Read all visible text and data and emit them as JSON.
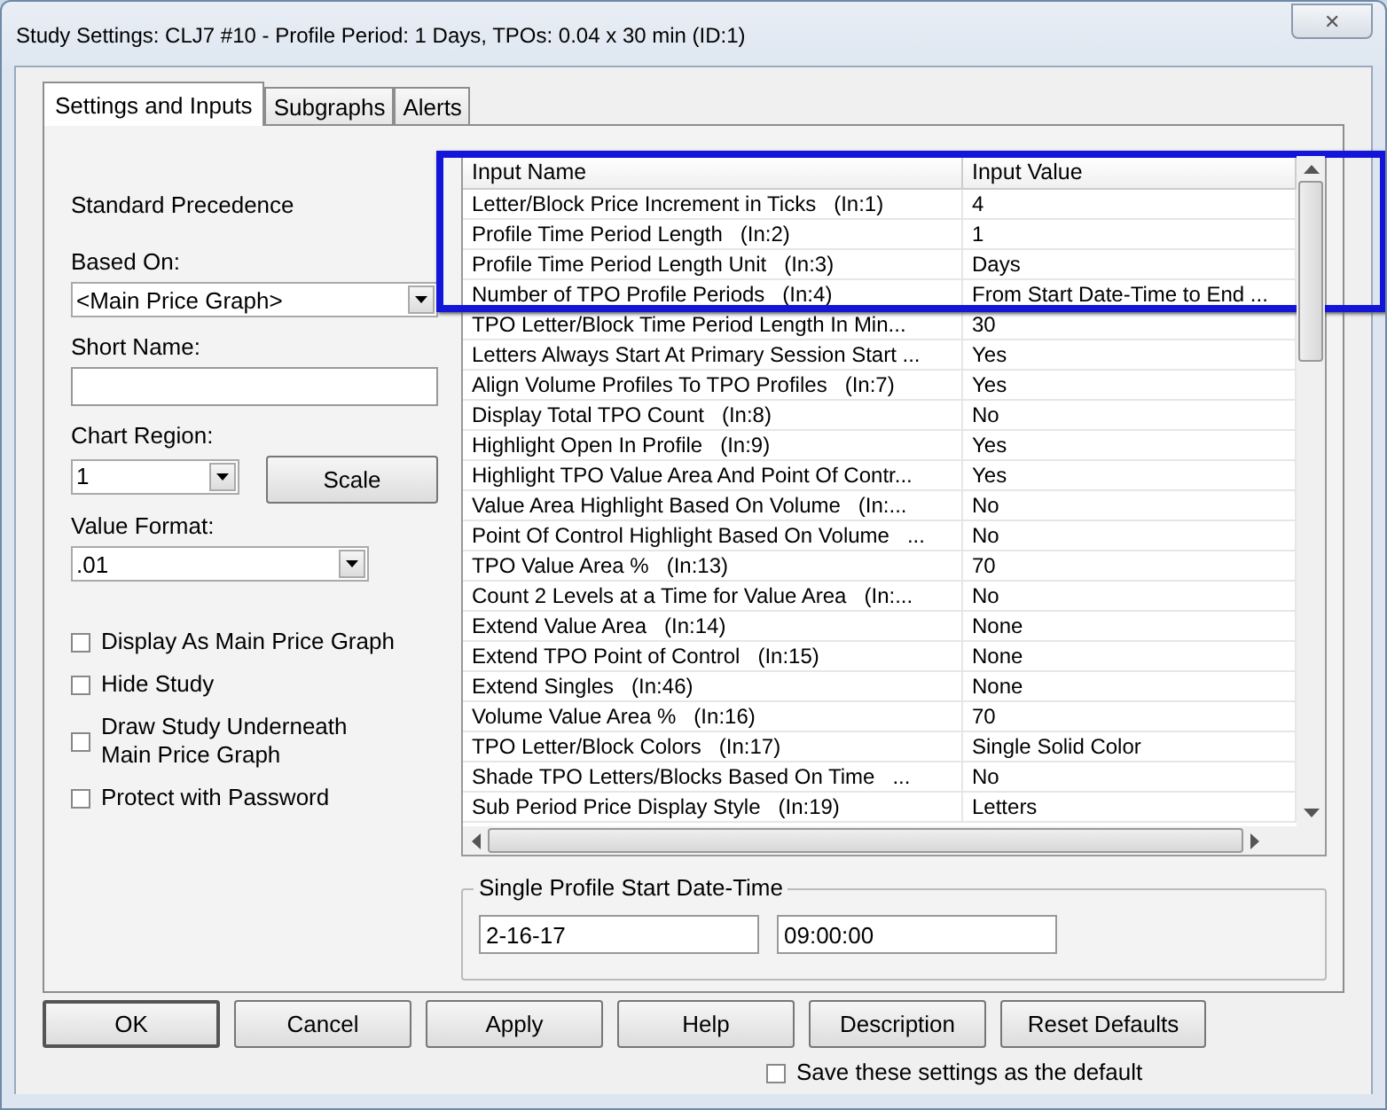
{
  "window": {
    "title": "Study Settings: CLJ7  #10 - Profile Period: 1 Days, TPOs: 0.04 x 30 min   (ID:1)",
    "close": "✕"
  },
  "tabs": [
    {
      "label": "Settings and Inputs",
      "selected": true
    },
    {
      "label": "Subgraphs",
      "selected": false
    },
    {
      "label": "Alerts",
      "selected": false
    }
  ],
  "left": {
    "precedence": "Standard Precedence",
    "based_on": {
      "label": "Based On:",
      "value": "<Main Price Graph>"
    },
    "short_name": {
      "label": "Short Name:"
    },
    "chart_region": {
      "label": "Chart Region:",
      "value": "1"
    },
    "scale_button": "Scale",
    "value_format": {
      "label": "Value Format:",
      "value": ".01"
    },
    "checkboxes": [
      {
        "label": "Display As Main Price Graph",
        "checked": false
      },
      {
        "label": "Hide Study",
        "checked": false
      },
      {
        "label": "Draw Study Underneath Main Price Graph",
        "checked": false
      },
      {
        "label": "Protect with Password",
        "checked": false
      }
    ]
  },
  "inputs_table": {
    "columns": [
      "Input Name",
      "Input Value"
    ],
    "highlighted_rows": [
      {
        "name": "Letter/Block Price Increment in Ticks   (In:1)",
        "value": "4"
      },
      {
        "name": "Profile Time Period Length   (In:2)",
        "value": "1"
      },
      {
        "name": "Profile Time Period Length Unit   (In:3)",
        "value": "Days"
      },
      {
        "name": "Number of TPO Profile Periods   (In:4)",
        "value": "From Start Date-Time to End ..."
      }
    ],
    "rows": [
      {
        "name": "TPO Letter/Block Time Period Length In Min...",
        "value": "30"
      },
      {
        "name": "Letters Always Start At Primary Session Start ...",
        "value": "Yes"
      },
      {
        "name": "Align Volume Profiles To TPO Profiles   (In:7)",
        "value": "Yes"
      },
      {
        "name": "Display Total TPO Count   (In:8)",
        "value": "No"
      },
      {
        "name": "Highlight Open In Profile   (In:9)",
        "value": "Yes"
      },
      {
        "name": "Highlight TPO Value Area And Point Of Contr...",
        "value": "Yes"
      },
      {
        "name": "Value Area Highlight Based On Volume   (In:...",
        "value": "No"
      },
      {
        "name": "Point Of Control Highlight Based On Volume   ...",
        "value": "No"
      },
      {
        "name": "TPO Value Area %   (In:13)",
        "value": "70"
      },
      {
        "name": "Count 2 Levels at a Time for Value Area   (In:...",
        "value": "No"
      },
      {
        "name": "Extend Value Area   (In:14)",
        "value": "None"
      },
      {
        "name": "Extend TPO Point of Control   (In:15)",
        "value": "None"
      },
      {
        "name": "Extend Singles   (In:46)",
        "value": "None"
      },
      {
        "name": "Volume Value Area %   (In:16)",
        "value": "70"
      },
      {
        "name": "TPO Letter/Block Colors   (In:17)",
        "value": "Single Solid Color"
      },
      {
        "name": "Shade TPO Letters/Blocks Based On Time   ...",
        "value": "No"
      },
      {
        "name": "Sub Period Price Display Style   (In:19)",
        "value": "Letters"
      }
    ]
  },
  "start_group": {
    "title": "Single Profile Start Date-Time",
    "date": "2-16-17",
    "time": "09:00:00"
  },
  "buttons": [
    "OK",
    "Cancel",
    "Apply",
    "Help",
    "Description",
    "Reset Defaults"
  ],
  "save_default": {
    "label": "Save these settings as the default",
    "checked": false
  }
}
